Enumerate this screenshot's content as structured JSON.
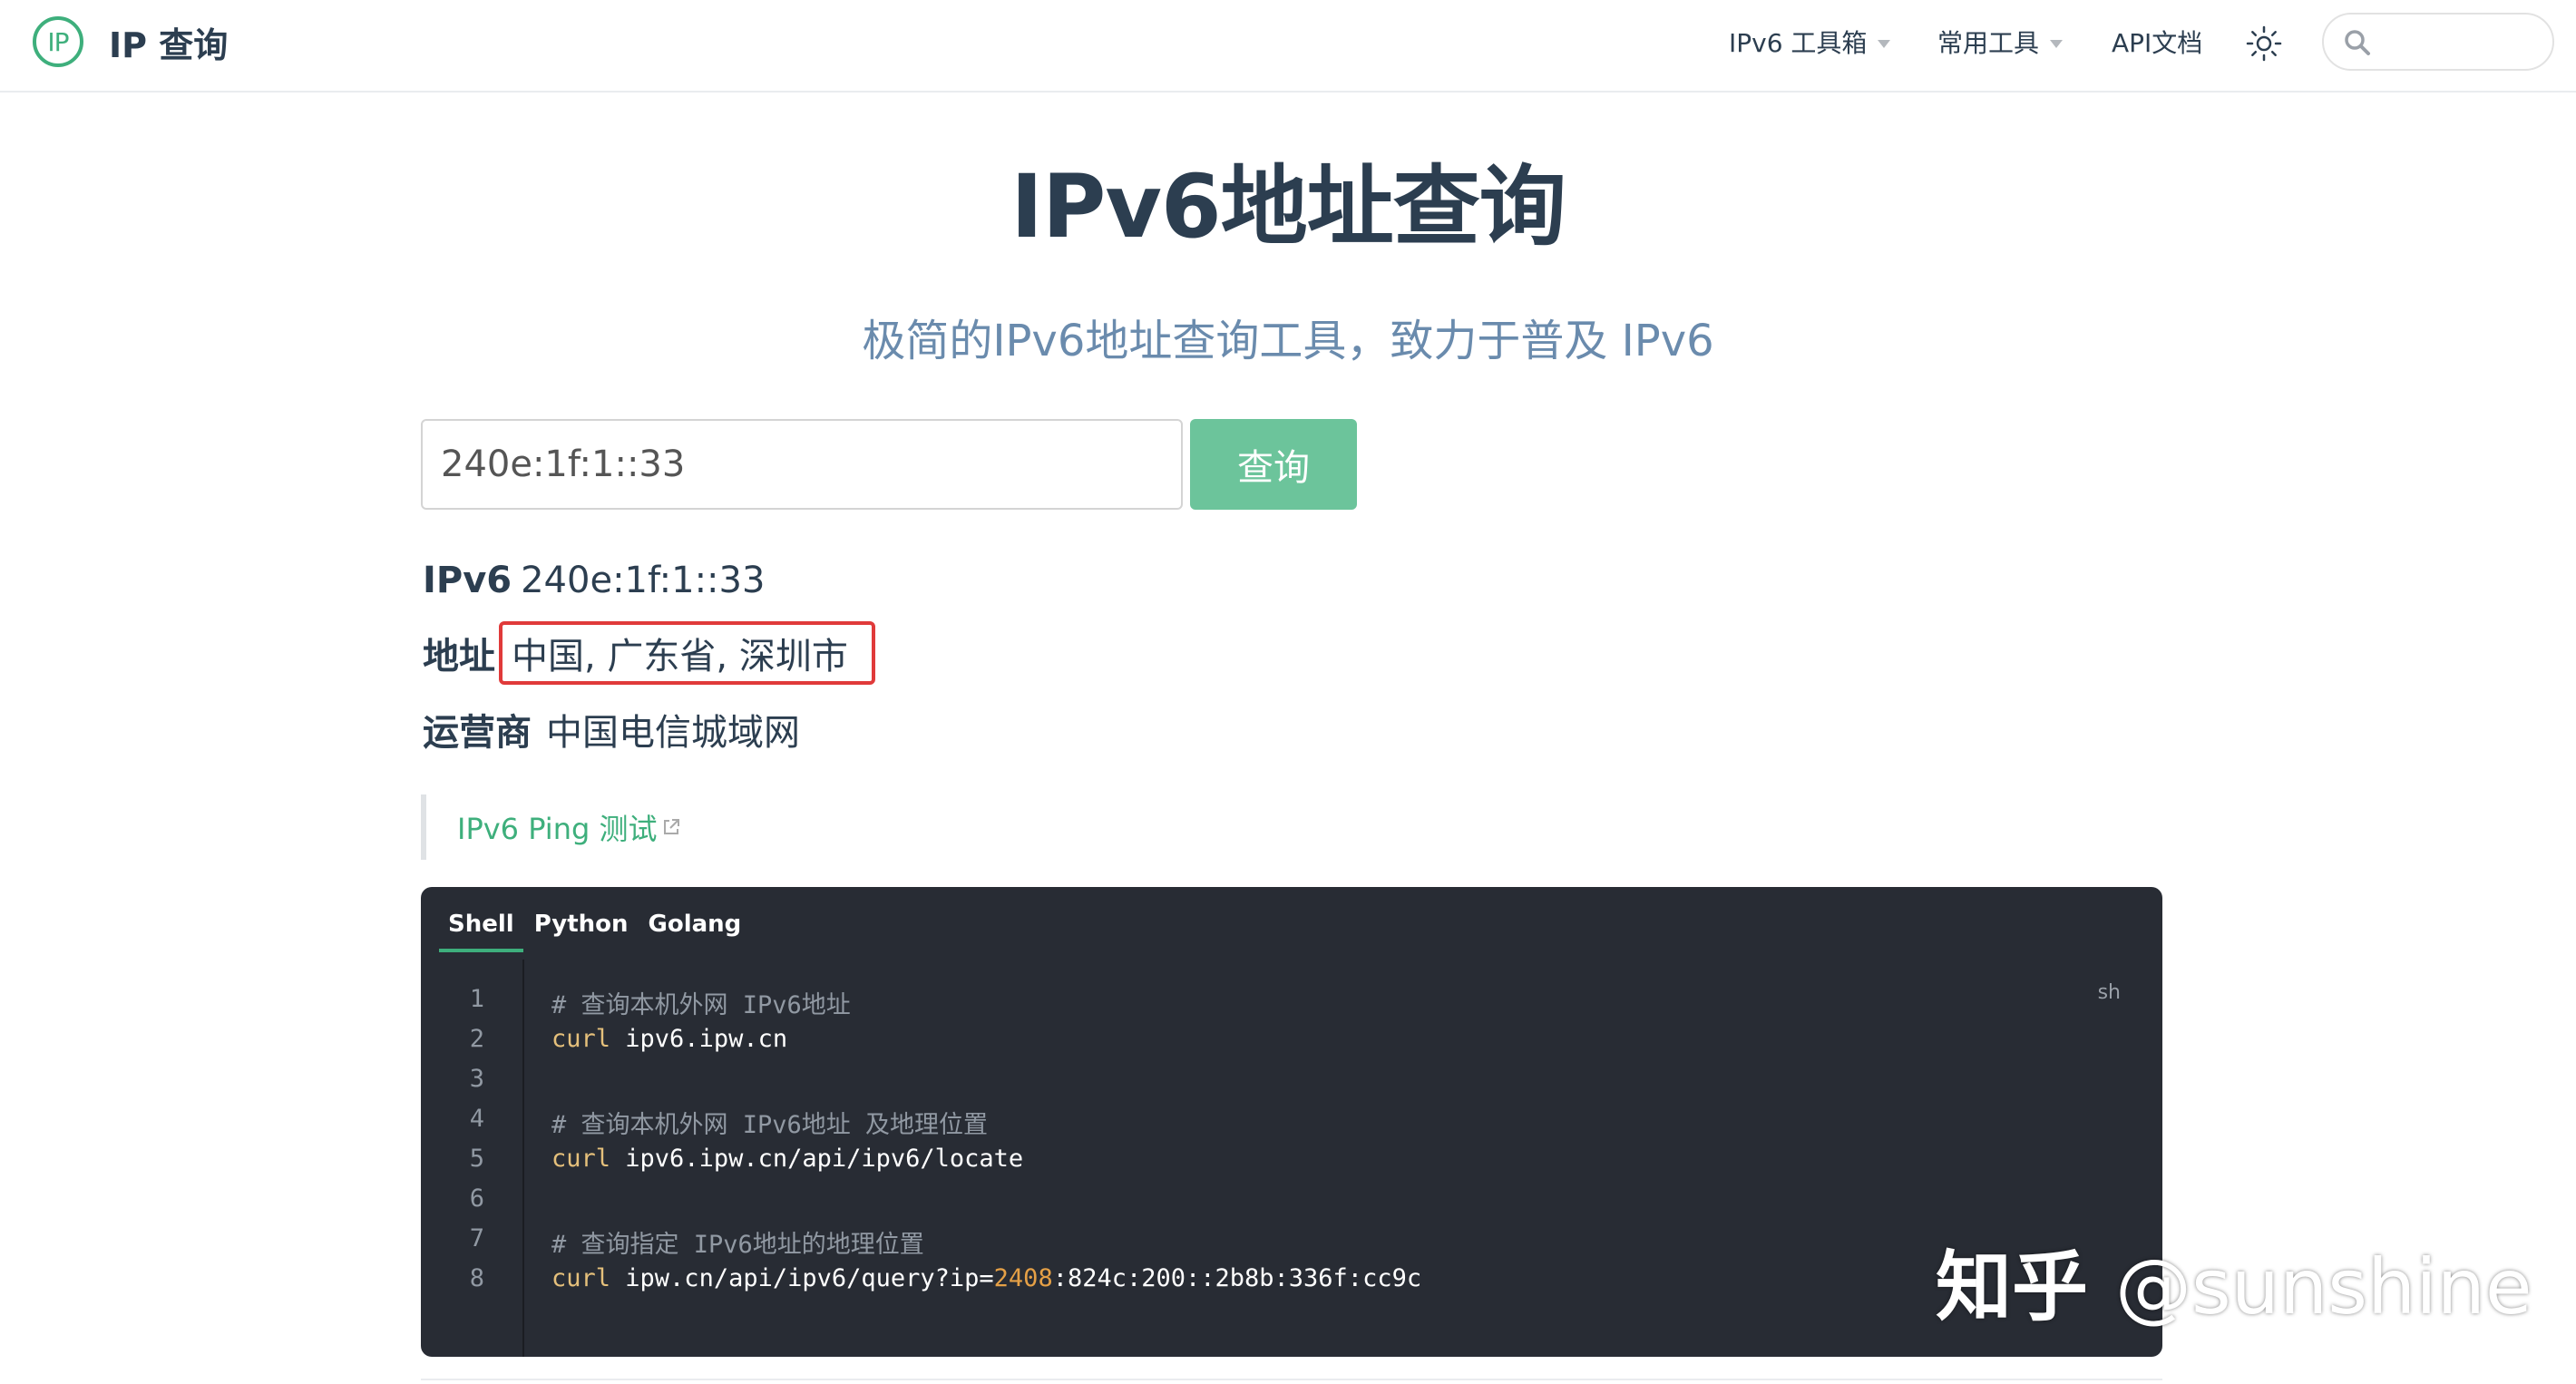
{
  "nav": {
    "brand_logo": "IP",
    "brand_title": "IP 查询",
    "items": [
      {
        "label": "IPv6 工具箱",
        "dropdown": true
      },
      {
        "label": "常用工具",
        "dropdown": true
      },
      {
        "label": "API文档",
        "dropdown": false
      }
    ],
    "theme_icon": "sun-icon",
    "search_icon": "search-icon",
    "search_placeholder": ""
  },
  "hero": {
    "title": "IPv6地址查询",
    "subtitle": "极简的IPv6地址查询工具，致力于普及 IPv6"
  },
  "form": {
    "input_value": "240e:1f:1::33",
    "button_label": "查询"
  },
  "result": {
    "ipv6_label": "IPv6",
    "ipv6_value": "240e:1f:1::33",
    "address_label": "地址",
    "address_value": "中国, 广东省, 深圳市",
    "isp_label": "运营商",
    "isp_value": "中国电信城域网"
  },
  "ping": {
    "link_label": "IPv6 Ping 测试",
    "link_icon": "external-link-icon"
  },
  "code": {
    "tabs": [
      "Shell",
      "Python",
      "Golang"
    ],
    "active_tab": "Shell",
    "language": "sh",
    "line_numbers": [
      "1",
      "2",
      "3",
      "4",
      "5",
      "6",
      "7",
      "8"
    ],
    "lines": {
      "l1": "# 查询本机外网 IPv6地址",
      "l2_cmd": "curl",
      "l2_rest": " ipv6.ipw.cn",
      "l4": "# 查询本机外网 IPv6地址 及地理位置",
      "l5_cmd": "curl",
      "l5_rest": " ipv6.ipw.cn/api/ipv6/locate",
      "l7": "# 查询指定 IPv6地址的地理位置",
      "l8_cmd": "curl",
      "l8_mid": " ipw.cn/api/ipv6/query?ip=",
      "l8_num": "2408",
      "l8_rest": ":824c:200::2b8b:336f:cc9c"
    }
  },
  "watermark": {
    "brand": "知乎",
    "handle": "@sunshine"
  },
  "colors": {
    "accent": "#3eaf7c",
    "button": "#6cc49b",
    "highlight_border": "#e03a3a",
    "code_bg": "#282c34",
    "subtitle": "#6a8bad"
  }
}
